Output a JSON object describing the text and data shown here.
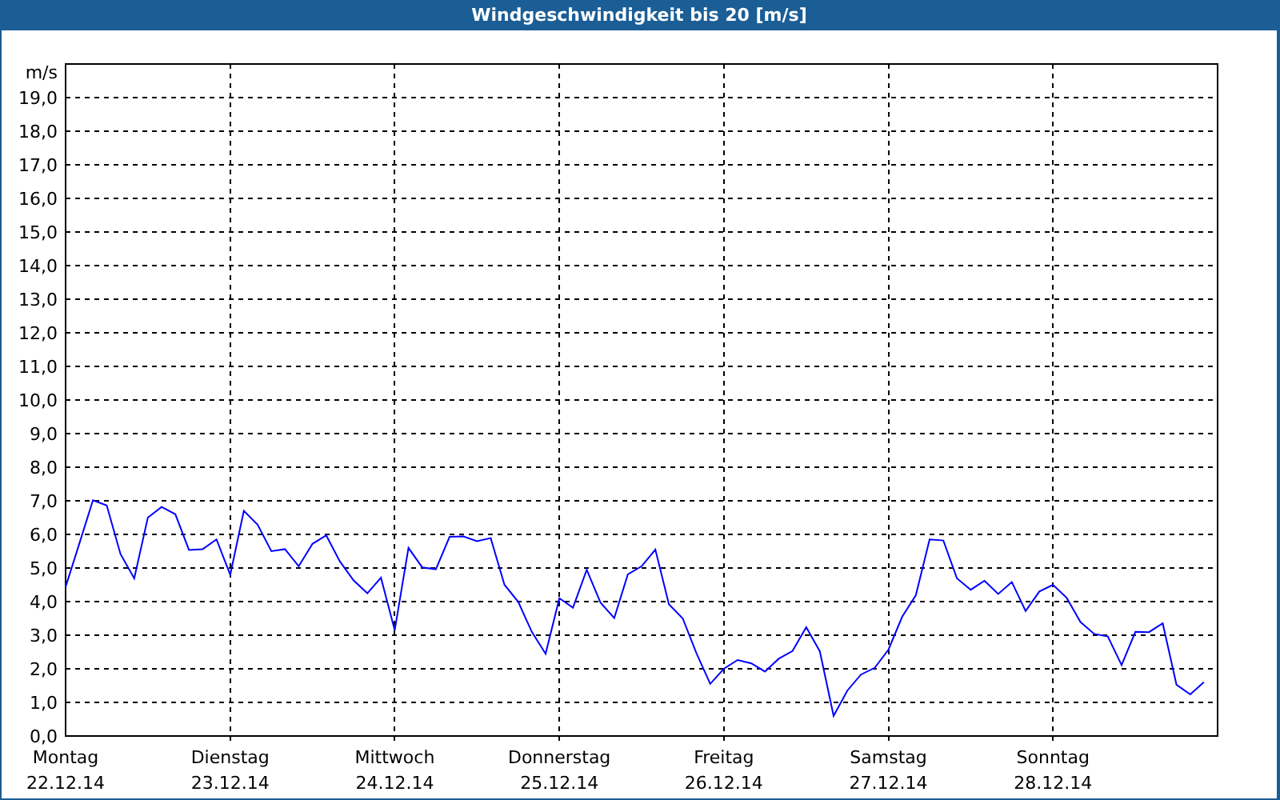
{
  "chart": {
    "chart_data": {
      "type": "line",
      "title": "Windgeschwindigkeit bis 20 [m/s]",
      "ylabel": "m/s",
      "categories": [
        "Montag\n22.12.14",
        null,
        null,
        null,
        null,
        null,
        null,
        null,
        null,
        null,
        null,
        null,
        "Dienstag\n23.12.14",
        null,
        null,
        null,
        null,
        null,
        null,
        null,
        null,
        null,
        null,
        null,
        "Mittwoch\n24.12.14",
        null,
        null,
        null,
        null,
        null,
        null,
        null,
        null,
        null,
        null,
        null,
        "Donnerstag\n25.12.14",
        null,
        null,
        null,
        null,
        null,
        null,
        null,
        null,
        null,
        null,
        null,
        "Freitag\n26.12.14",
        null,
        null,
        null,
        null,
        null,
        null,
        null,
        null,
        null,
        null,
        null,
        "Samstag\n27.12.14",
        null,
        null,
        null,
        null,
        null,
        null,
        null,
        null,
        null,
        null,
        null,
        "Sonntag\n28.12.14",
        null,
        null,
        null,
        null,
        null,
        null,
        null,
        null,
        null,
        null,
        null,
        null
      ],
      "series": [
        {
          "color": "#0000ff",
          "values": [
            4.44,
            5.73,
            7.02,
            6.86,
            5.42,
            4.69,
            6.5,
            6.82,
            6.6,
            5.54,
            5.56,
            5.85,
            4.8,
            6.7,
            6.29,
            5.5,
            5.56,
            5.05,
            5.72,
            5.97,
            5.2,
            4.63,
            4.25,
            4.71,
            3.15,
            5.6,
            5.02,
            4.96,
            5.93,
            5.94,
            5.8,
            5.89,
            4.5,
            3.99,
            3.1,
            2.45,
            4.1,
            3.82,
            4.95,
            3.97,
            3.51,
            4.81,
            5.05,
            5.55,
            3.92,
            3.5,
            2.46,
            1.55,
            2.0,
            2.26,
            2.16,
            1.92,
            2.3,
            2.53,
            3.24,
            2.52,
            0.6,
            1.35,
            1.83,
            2.03,
            2.57,
            3.55,
            4.19,
            5.85,
            5.82,
            4.69,
            4.35,
            4.62,
            4.23,
            4.58,
            3.72,
            4.3,
            4.5,
            4.11,
            3.39,
            3.04,
            2.96,
            2.11,
            3.1,
            3.09,
            3.35,
            1.53,
            1.24,
            1.6,
            null
          ]
        }
      ],
      "ylim": [
        0,
        20
      ],
      "grid": true,
      "yticks": [
        {
          "value": 0,
          "label": "0,0"
        },
        {
          "value": 1,
          "label": "1,0"
        },
        {
          "value": 2,
          "label": "2,0"
        },
        {
          "value": 3,
          "label": "3,0"
        },
        {
          "value": 4,
          "label": "4,0"
        },
        {
          "value": 5,
          "label": "5,0"
        },
        {
          "value": 6,
          "label": "6,0"
        },
        {
          "value": 7,
          "label": "7,0"
        },
        {
          "value": 8,
          "label": "8,0"
        },
        {
          "value": 9,
          "label": "9,0"
        },
        {
          "value": 10,
          "label": "10,0"
        },
        {
          "value": 11,
          "label": "11,0"
        },
        {
          "value": 12,
          "label": "12,0"
        },
        {
          "value": 13,
          "label": "13,0"
        },
        {
          "value": 14,
          "label": "14,0"
        },
        {
          "value": 15,
          "label": "15,0"
        },
        {
          "value": 16,
          "label": "16,0"
        },
        {
          "value": 17,
          "label": "17,0"
        },
        {
          "value": 18,
          "label": "18,0"
        },
        {
          "value": 19,
          "label": "19,0"
        }
      ]
    }
  }
}
